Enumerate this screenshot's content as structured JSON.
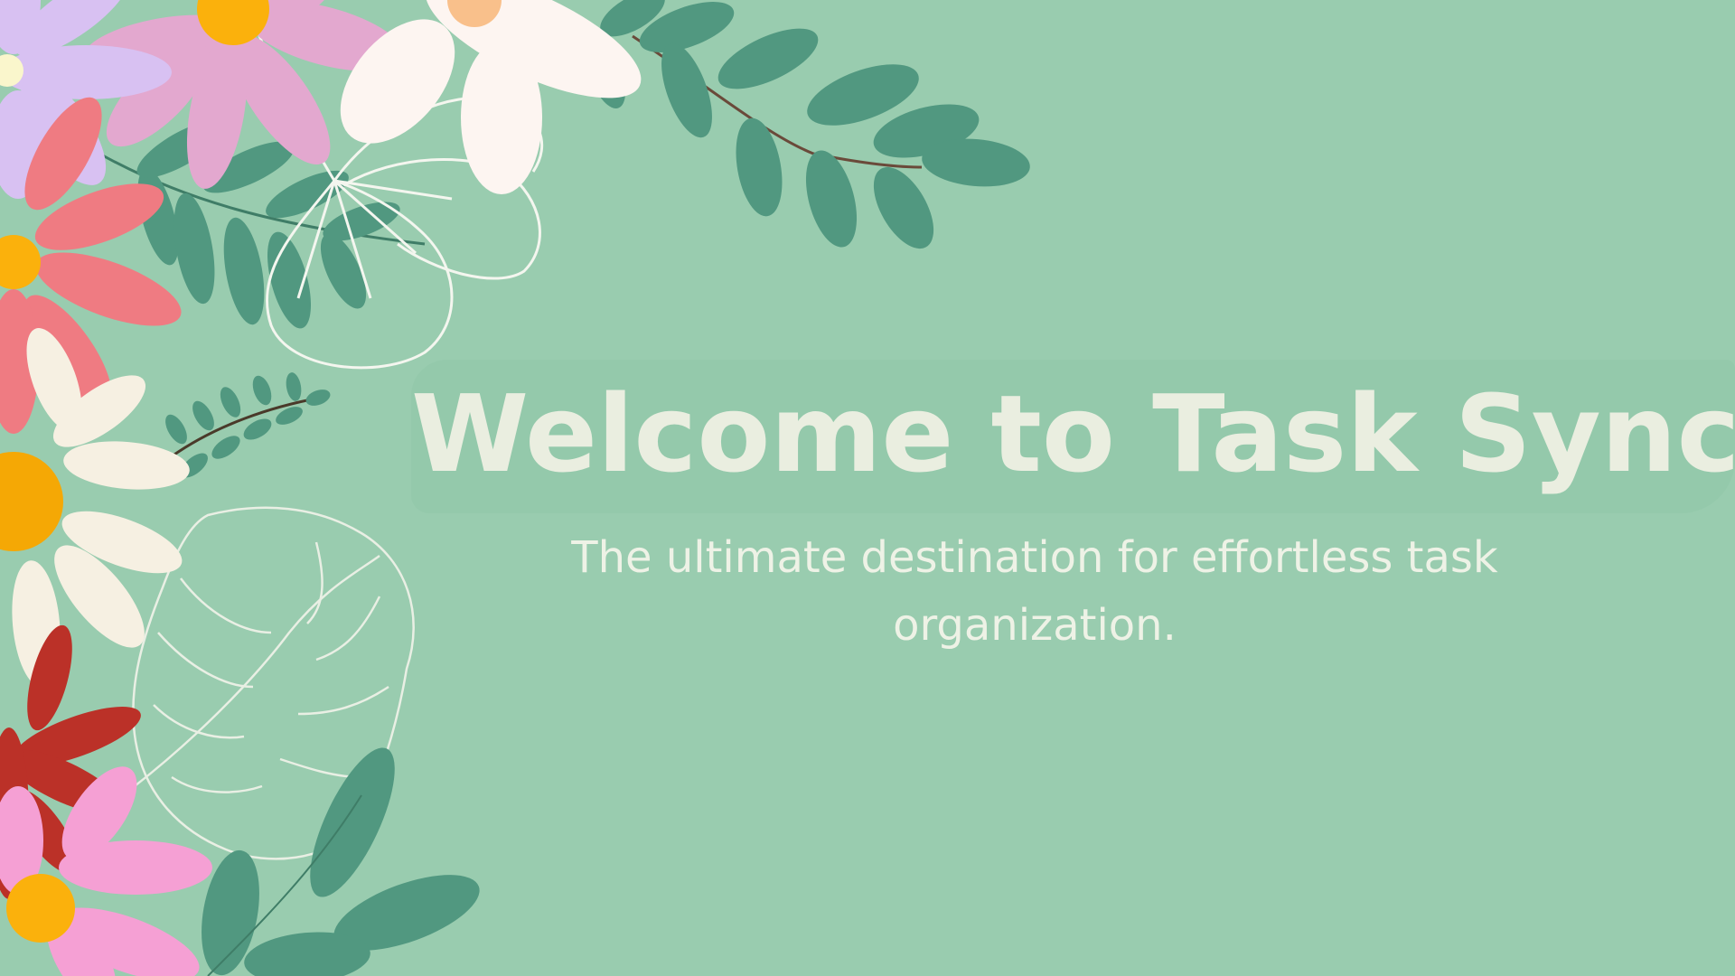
{
  "slide": {
    "title": "Welcome to Task Sync!",
    "subtitle": "The ultimate destination for effortless task organization."
  },
  "colors": {
    "background": "#99ccaf",
    "title_text": "#eaeee0",
    "leaf": "#519880",
    "pink_flower": "#e3a8cf",
    "lavender_flower": "#d8c1f2",
    "coral_flower": "#ef7b82",
    "cream_flower": "#f6f0e2",
    "red_flower": "#bb3128",
    "bright_pink_flower": "#f5a0d4",
    "flower_center": "#fbb10c"
  },
  "decorations": {
    "top_left": "floral-cluster-illustration",
    "left_edge": "flower-column-illustration",
    "top_center": "eucalyptus-branch-illustration",
    "bottom_left": "monstera-outline-illustration"
  }
}
